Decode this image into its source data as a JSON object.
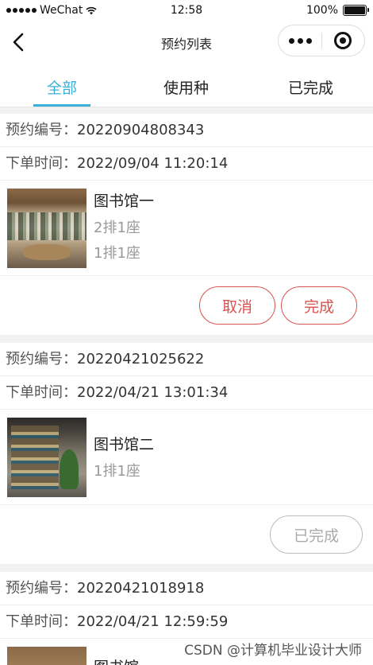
{
  "status_bar": {
    "carrier": "WeChat",
    "time": "12:58",
    "battery": "100%"
  },
  "nav": {
    "title": "预约列表"
  },
  "tabs": [
    {
      "label": "全部",
      "active": true
    },
    {
      "label": "使用种",
      "active": false
    },
    {
      "label": "已完成",
      "active": false
    }
  ],
  "labels": {
    "order_no": "预约编号：",
    "order_time": "下单时间："
  },
  "orders": [
    {
      "order_no": "20220904808343",
      "order_time": "2022/09/04 11:20:14",
      "library": "图书馆一",
      "seats": [
        "2排1座",
        "1排1座"
      ],
      "actions": [
        "取消",
        "完成"
      ]
    },
    {
      "order_no": "20220421025622",
      "order_time": "2022/04/21 13:01:34",
      "library": "图书馆二",
      "seats": [
        "1排1座"
      ],
      "status_label": "已完成"
    },
    {
      "order_no": "20220421018918",
      "order_time": "2022/04/21 12:59:59",
      "library": "图书馆"
    }
  ],
  "watermark": "CSDN @计算机毕业设计大师",
  "colors": {
    "accent": "#3bb0d9",
    "action_red": "#d9534f",
    "muted": "#aaaaaa"
  }
}
